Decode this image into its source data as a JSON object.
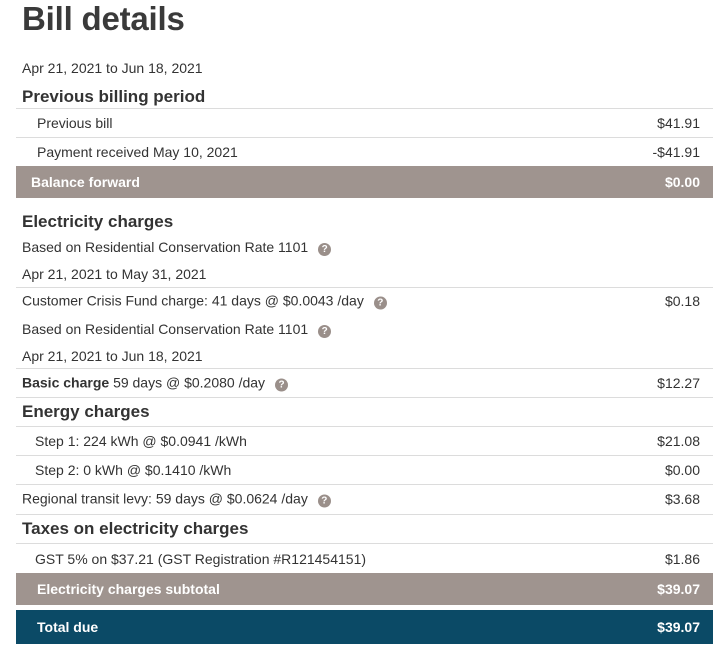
{
  "page_title": "Bill details",
  "period": "Apr 21, 2021 to Jun 18, 2021",
  "previous": {
    "heading": "Previous billing period",
    "rows": [
      {
        "label": "Previous bill",
        "amount": "$41.91"
      },
      {
        "label": "Payment received May 10, 2021",
        "amount": "-$41.91"
      }
    ],
    "balance_label": "Balance forward",
    "balance_amount": "$0.00"
  },
  "electricity": {
    "heading": "Electricity charges",
    "rate1": "Based on Residential Conservation Rate 1101",
    "rate1_period": "Apr 21, 2021 to May 31, 2021",
    "crisis_label": "Customer Crisis Fund charge: 41 days @ $0.0043 /day",
    "crisis_amount": "$0.18",
    "rate2": "Based on Residential Conservation Rate 1101",
    "rate2_period": "Apr 21, 2021 to Jun 18, 2021",
    "basic_bold": "Basic charge",
    "basic_rest": "59 days @ $0.2080 /day",
    "basic_amount": "$12.27"
  },
  "energy": {
    "heading": "Energy charges",
    "step1_label": "Step 1: 224 kWh @ $0.0941 /kWh",
    "step1_amount": "$21.08",
    "step2_label": "Step 2: 0 kWh @ $0.1410 /kWh",
    "step2_amount": "$0.00",
    "transit_label": "Regional transit levy: 59 days @ $0.0624 /day",
    "transit_amount": "$3.68"
  },
  "taxes": {
    "heading": "Taxes on electricity charges",
    "gst_label": "GST 5% on $37.21 (GST Registration #R121454151)",
    "gst_amount": "$1.86"
  },
  "subtotal": {
    "label": "Electricity charges subtotal",
    "amount": "$39.07"
  },
  "total": {
    "label": "Total due",
    "amount": "$39.07"
  },
  "colors": {
    "band_gray": "#9f948f",
    "band_blue": "#0b4a66",
    "help_icon": "#9a8f8a"
  },
  "icons": {
    "help": "question-circle-icon",
    "help_glyph": "?"
  }
}
